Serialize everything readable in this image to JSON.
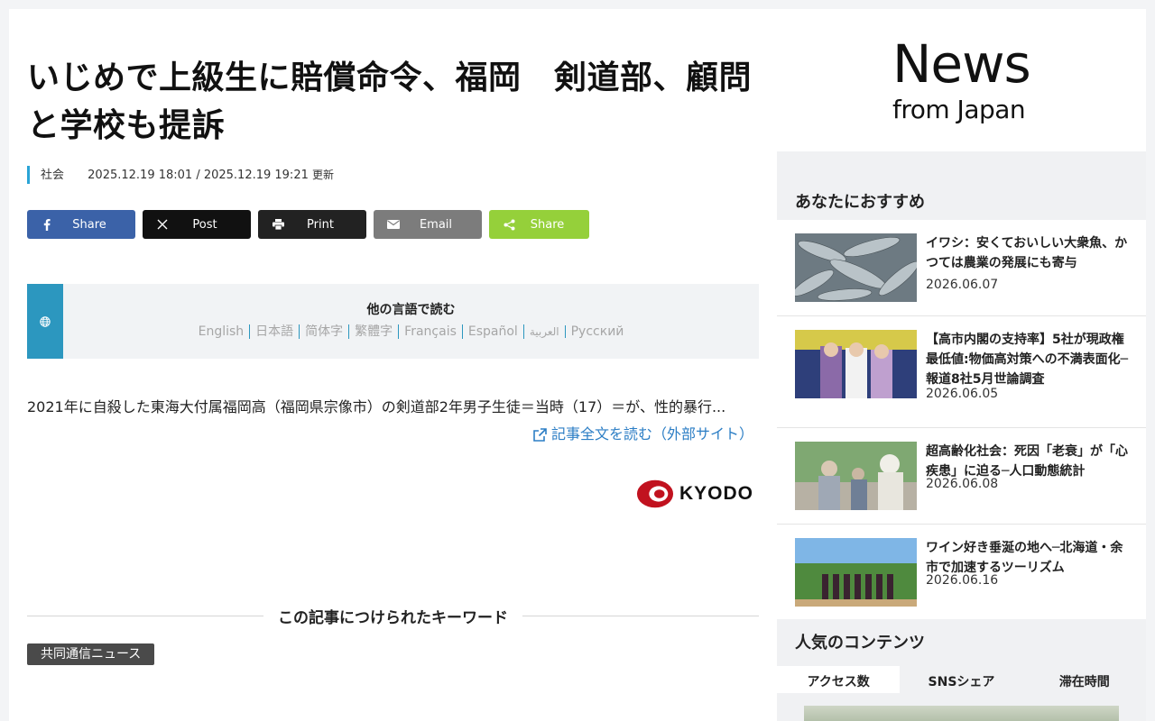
{
  "article": {
    "title": "いじめで上級生に賠償命令、福岡　剣道部、顧問と学校も提訴",
    "category": "社会",
    "dates": "2025.12.19 18:01 / 2025.12.19 19:21",
    "updated_label": "更新",
    "excerpt": "2021年に自殺した東海大付属福岡高（福岡県宗像市）の剣道部2年男子生徒＝当時（17）＝が、性的暴行...",
    "read_more": "記事全文を読む（外部サイト）",
    "source": "KYODO"
  },
  "share": {
    "facebook": "Share",
    "x": "Post",
    "print": "Print",
    "email": "Email",
    "share": "Share"
  },
  "languages": {
    "title": "他の言語で読む",
    "items": [
      "English",
      "日本語",
      "简体字",
      "繁體字",
      "Français",
      "Español",
      "العربية",
      "Русский"
    ]
  },
  "keywords": {
    "title": "この記事につけられたキーワード",
    "tags": [
      "共同通信ニュース"
    ]
  },
  "sidebar": {
    "logo_line1": "News",
    "logo_line2": "from Japan",
    "recommended_title": "あなたにおすすめ",
    "recommended": [
      {
        "title": "イワシ：安くておいしい大衆魚、かつては農業の発展にも寄与",
        "date": "2026.06.07"
      },
      {
        "title": "【高市内閣の支持率】5社が現政権最低値:物価高対策への不満表面化─報道8社5月世論調査",
        "date": "2026.06.05"
      },
      {
        "title": "超高齢化社会：死因「老衰」が「心疾患」に迫る─人口動態統計",
        "date": "2026.06.08"
      },
      {
        "title": "ワイン好き垂涎の地へ─北海道・余市で加速するツーリズム",
        "date": "2026.06.16"
      }
    ],
    "popular_title": "人気のコンテンツ",
    "popular_tabs": [
      "アクセス数",
      "SNSシェア",
      "滞在時間"
    ]
  },
  "colors": {
    "accent": "#2aa4d6",
    "facebook": "#3b62a8",
    "share_green": "#95d03a",
    "link": "#2c7ec5"
  }
}
